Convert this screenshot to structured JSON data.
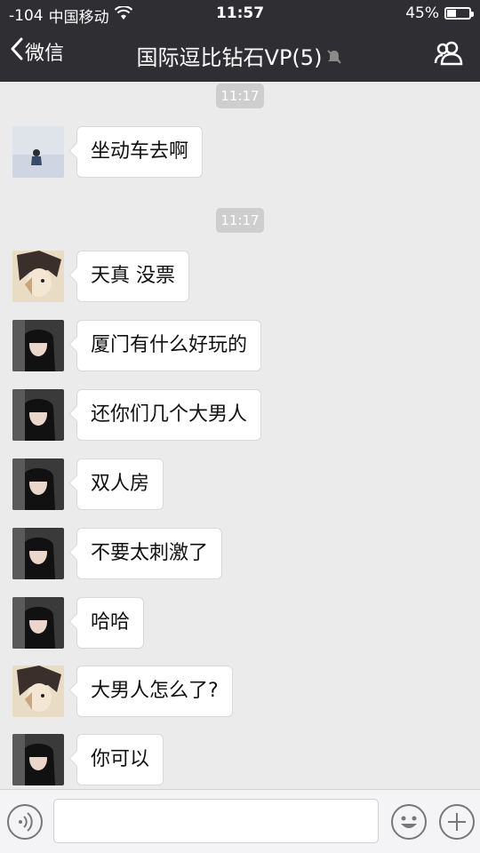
{
  "status_bar": {
    "signal": "-104",
    "carrier": "中国移动",
    "time": "11:57",
    "battery": "45%"
  },
  "nav": {
    "back_label": "微信",
    "title": "国际逗比钻石VP(5)"
  },
  "timestamps": [
    "11:17",
    "11:17"
  ],
  "messages": [
    {
      "avatar": "avatar-girl-sea",
      "text": "坐动车去啊"
    },
    {
      "avatar": "avatar-anime",
      "text": "天真 没票"
    },
    {
      "avatar": "avatar-dark-hair",
      "text": "厦门有什么好玩的"
    },
    {
      "avatar": "avatar-dark-hair",
      "text": "还你们几个大男人"
    },
    {
      "avatar": "avatar-dark-hair",
      "text": "双人房"
    },
    {
      "avatar": "avatar-dark-hair",
      "text": "不要太刺激了"
    },
    {
      "avatar": "avatar-dark-hair",
      "text": "哈哈"
    },
    {
      "avatar": "avatar-anime",
      "text": "大男人怎么了?"
    },
    {
      "avatar": "avatar-dark-hair",
      "text": "你可以"
    }
  ],
  "input_bar": {
    "icons": [
      "voice-icon",
      "emoji-icon",
      "plus-icon"
    ]
  }
}
